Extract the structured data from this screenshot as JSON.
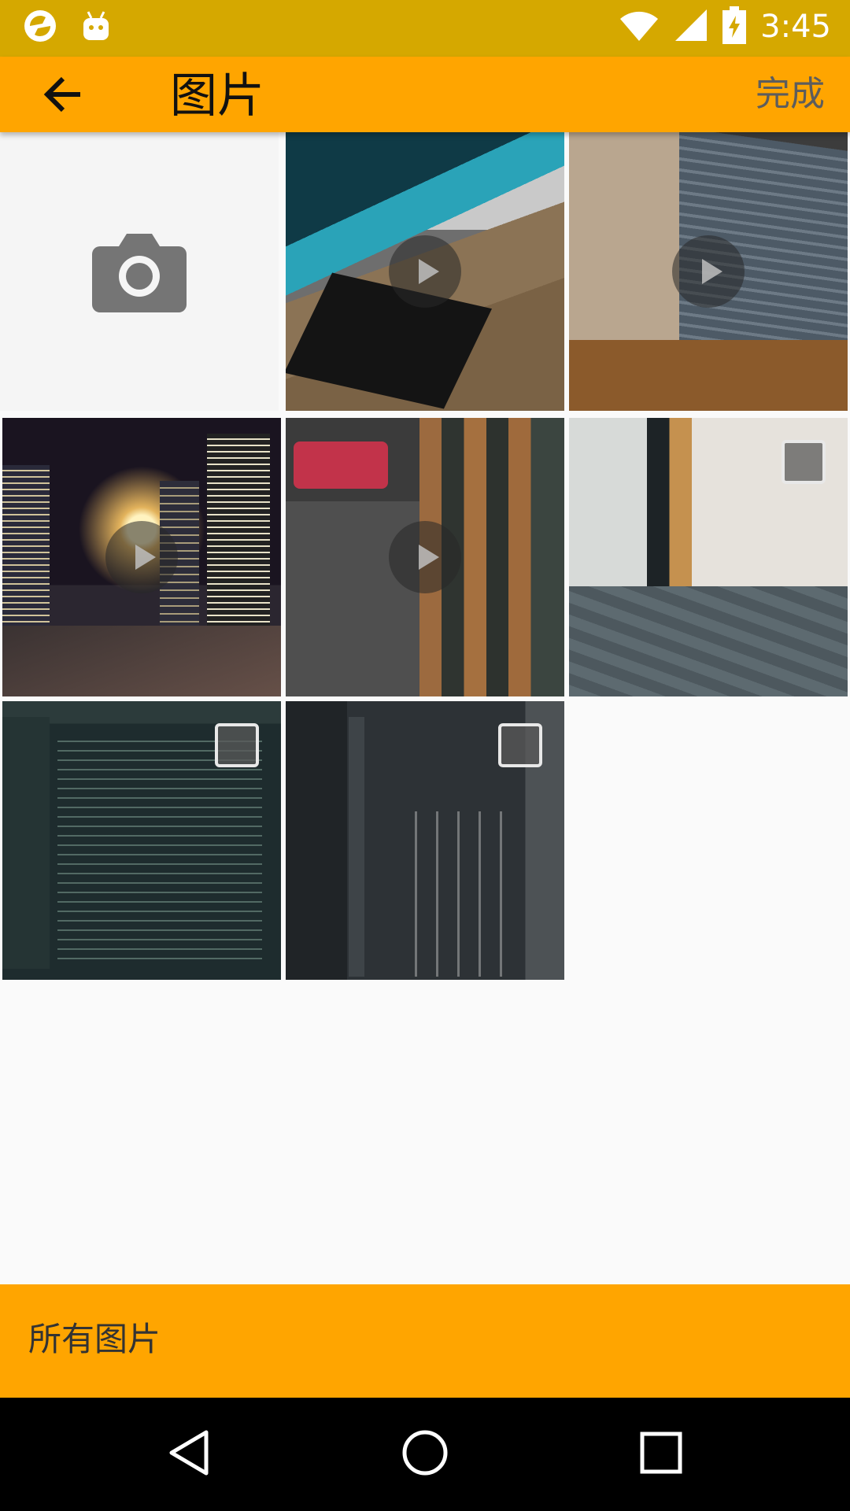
{
  "status_bar": {
    "time": "3:45",
    "icons": [
      "sync-icon",
      "android-icon",
      "wifi-icon",
      "cell-signal-icon",
      "battery-charging-icon"
    ]
  },
  "app_bar": {
    "title": "图片",
    "done_label": "完成",
    "back_icon": "back-arrow-icon"
  },
  "grid": {
    "camera_icon": "camera-icon",
    "items": [
      {
        "type": "camera"
      },
      {
        "type": "video"
      },
      {
        "type": "video"
      },
      {
        "type": "video"
      },
      {
        "type": "video"
      },
      {
        "type": "photo",
        "selected": false
      },
      {
        "type": "photo",
        "selected": false
      },
      {
        "type": "photo",
        "selected": false
      }
    ]
  },
  "bottom_bar": {
    "album_label": "所有图片"
  },
  "nav_bar": {
    "icons": [
      "back-triangle-icon",
      "home-circle-icon",
      "recents-square-icon"
    ]
  },
  "colors": {
    "status_bar": "#d5a800",
    "app_bar": "#ffa500",
    "bottom_bar": "#ffa500",
    "nav_bar": "#000000"
  }
}
